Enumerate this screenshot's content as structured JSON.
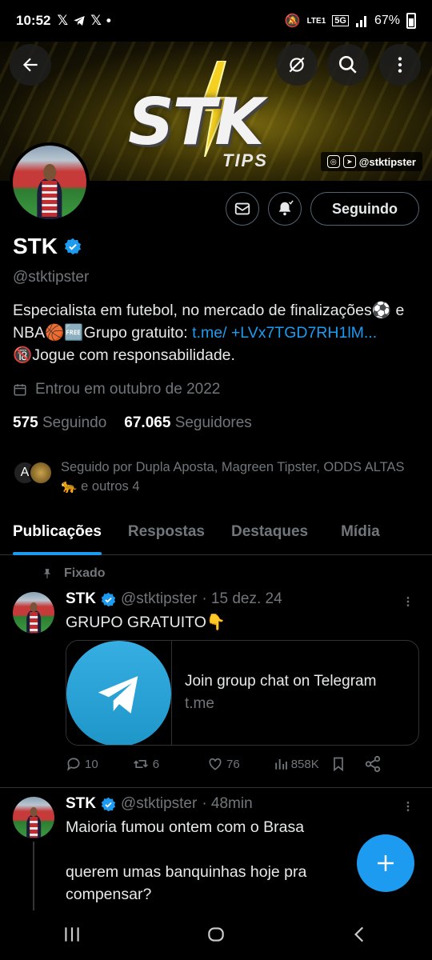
{
  "status_bar": {
    "time": "10:52",
    "notif_icons": [
      "x-logo-icon",
      "telegram-icon",
      "x-logo-icon",
      "dot"
    ],
    "network": "LTE1",
    "signal_label": "5G",
    "battery": "67%"
  },
  "banner": {
    "logo_main": "STK",
    "logo_sub": "TIPS",
    "handle": "@stktipster",
    "accent": "#f5d020"
  },
  "profile": {
    "name": "STK",
    "handle": "@stktipster",
    "bio_text": "Especialista em futebol, no mercado de finalizações⚽ e NBA🏀🆓Grupo gratuito: ",
    "bio_link": "t.me/ +LVx7TGD7RH1lM...",
    "bio_tail": " 🔞Jogue com responsabilidade.",
    "joined": "Entrou em outubro de 2022",
    "following_count": "575",
    "following_label": "Seguindo",
    "followers_count": "67.065",
    "followers_label": "Seguidores",
    "followed_by": "Seguido por Dupla Aposta, Magreen Tipster, ODDS ALTAS 🐆 e outros 4",
    "follow_button": "Seguindo"
  },
  "tabs": [
    "Publicações",
    "Respostas",
    "Destaques",
    "Mídia"
  ],
  "posts": [
    {
      "pinned_label": "Fixado",
      "name": "STK",
      "handle": "@stktipster",
      "time": "· 15 dez. 24",
      "text": "GRUPO GRATUITO👇",
      "card_title": "Join group chat on Telegram",
      "card_domain": "t.me",
      "replies": "10",
      "reposts": "6",
      "likes": "76",
      "views": "858K"
    },
    {
      "name": "STK",
      "handle": "@stktipster",
      "time": "· 48min",
      "text": "Maioria fumou ontem com o Brasa\n\nquerem umas banquinhas hoje pra compensar?"
    }
  ],
  "colors": {
    "accent_blue": "#1d9bf0",
    "muted": "#71767b",
    "border": "#2f3336"
  }
}
